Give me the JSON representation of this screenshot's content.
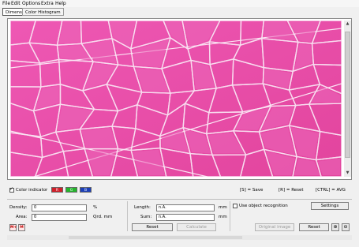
{
  "menu": {
    "items": [
      "File",
      "Edit",
      "Options",
      "Extra",
      "Help"
    ]
  },
  "toolbar": {
    "tabs": [
      {
        "label": "Dimension",
        "active": true
      },
      {
        "label": "Color Histogram",
        "active": false
      }
    ]
  },
  "image": {
    "description_icon": "microscope-tissue-image"
  },
  "status": {
    "color_indicator_label": "Color indicator",
    "color_indicator_checked": true,
    "chips": [
      {
        "label": "R",
        "color": "#d11f2a"
      },
      {
        "label": "G",
        "color": "#24b52c"
      },
      {
        "label": "B",
        "color": "#1c3fb8"
      }
    ],
    "save_hint": "[S] = Save",
    "reset_hint": "[R] = Reset",
    "avg_hint": "[CTRL] = AVG"
  },
  "measure": {
    "density_label": "Density:",
    "density_value": "0",
    "density_unit": "%",
    "area_label": "Area:",
    "area_value": "0",
    "area_unit": "Qrd. mm",
    "length_label": "Length:",
    "length_value": "n.A.",
    "length_unit": "mm",
    "sum_label": "Sum:",
    "sum_value": "n.A.",
    "sum_unit": "mm",
    "reset_button": "Reset",
    "calculate_button": "Calculate",
    "m_plus_button": "M+",
    "m_button": "M"
  },
  "recognition": {
    "use_object_recognition_label": "Use object recognition",
    "use_object_recognition_checked": false,
    "settings_button": "Settings",
    "original_image_button": "Original image",
    "reset_button": "Reset"
  },
  "colors": {
    "tissue_base": "#e64aa6",
    "membrane": "#f7dcef"
  }
}
